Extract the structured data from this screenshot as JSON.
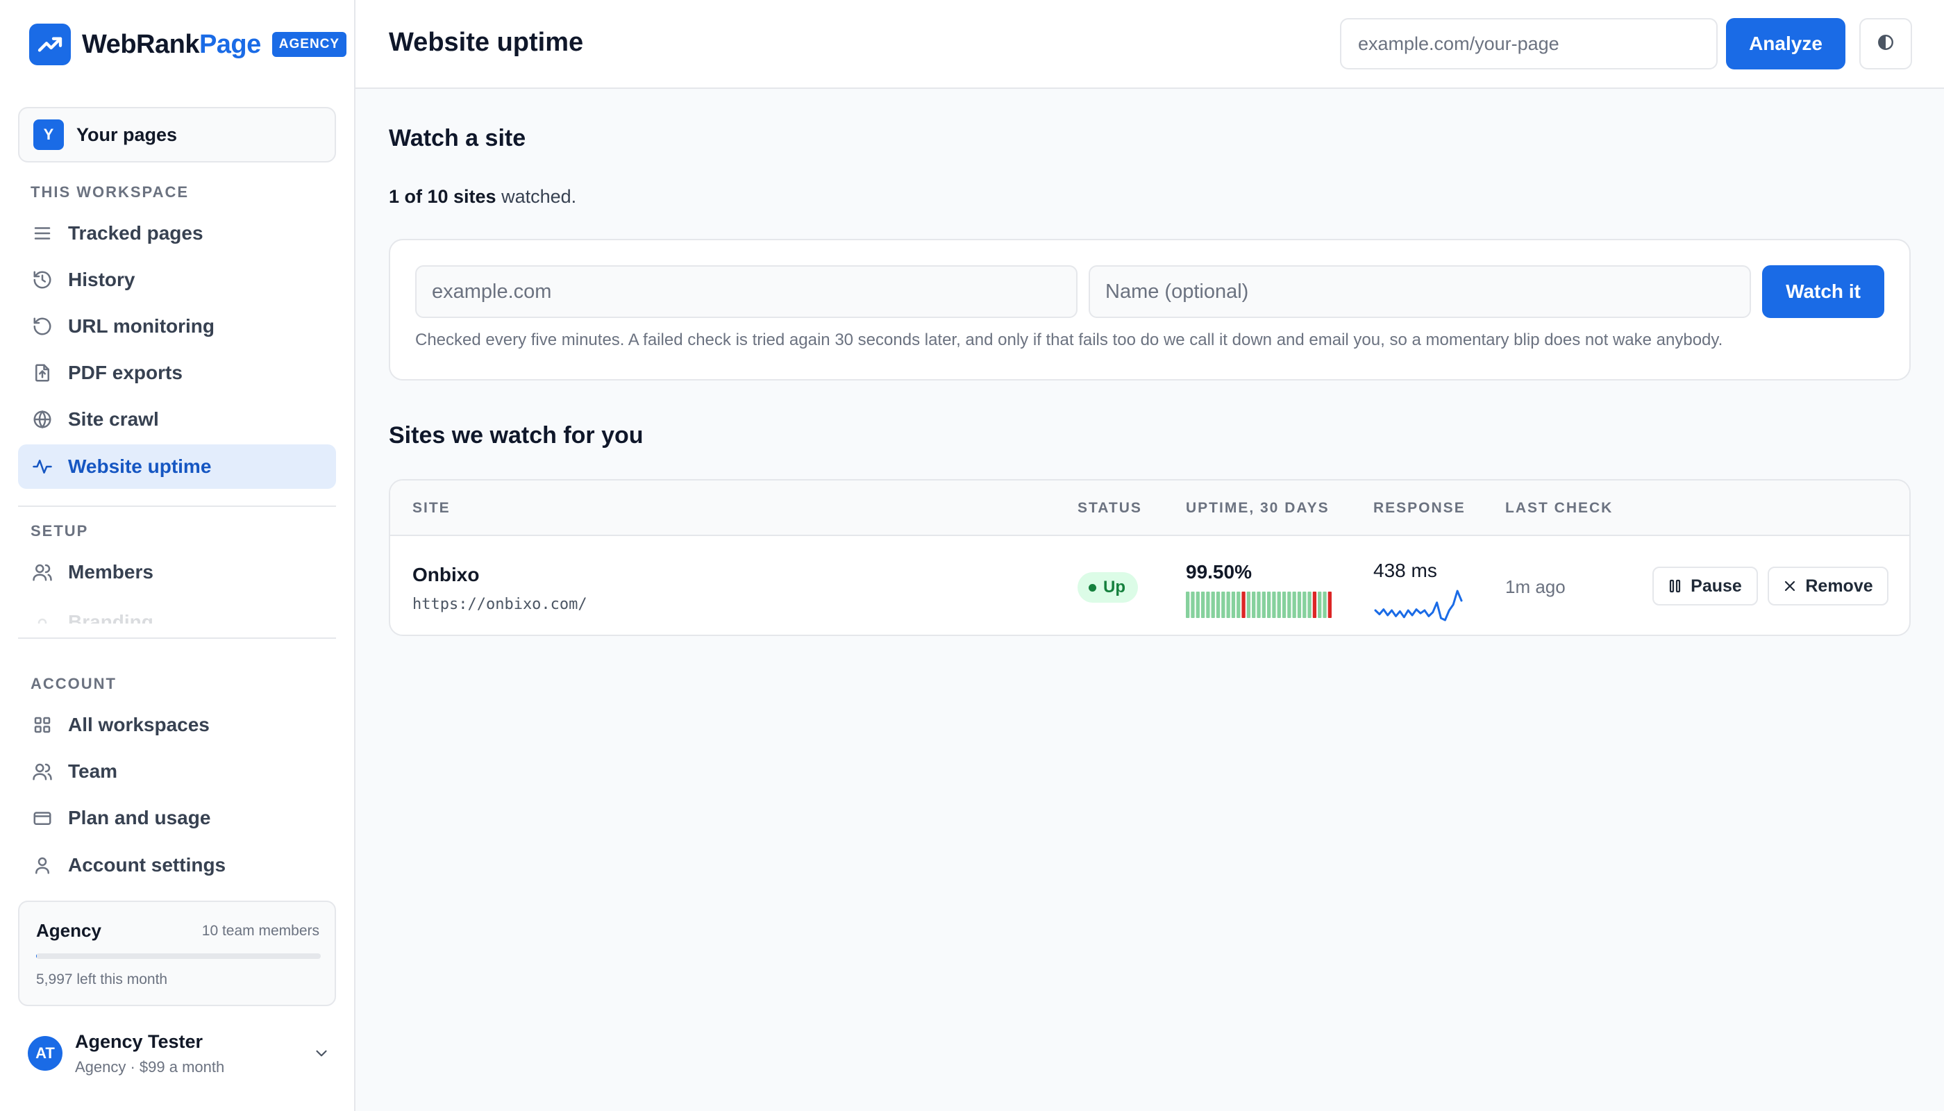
{
  "brand": {
    "name_main": "WebRank",
    "name_accent": "Page",
    "badge": "AGENCY"
  },
  "workspace_switch": {
    "avatar": "Y",
    "label": "Your pages"
  },
  "sidebar": {
    "workspace_section": "THIS WORKSPACE",
    "workspace_items": [
      {
        "label": "Tracked pages",
        "icon": "list-icon"
      },
      {
        "label": "History",
        "icon": "history-icon"
      },
      {
        "label": "URL monitoring",
        "icon": "refresh-icon"
      },
      {
        "label": "PDF exports",
        "icon": "file-export-icon"
      },
      {
        "label": "Site crawl",
        "icon": "globe-icon"
      },
      {
        "label": "Website uptime",
        "icon": "pulse-icon",
        "active": true
      }
    ],
    "setup_section": "SETUP",
    "setup_items": [
      {
        "label": "Members",
        "icon": "users-icon"
      },
      {
        "label": "Branding",
        "icon": "brush-icon"
      }
    ],
    "account_section": "ACCOUNT",
    "account_items": [
      {
        "label": "All workspaces",
        "icon": "grid-icon"
      },
      {
        "label": "Team",
        "icon": "team-icon"
      },
      {
        "label": "Plan and usage",
        "icon": "card-icon"
      },
      {
        "label": "Account settings",
        "icon": "user-icon"
      }
    ]
  },
  "plan": {
    "name": "Agency",
    "members": "10 team members",
    "left": "5,997 left this month",
    "usage_fraction": 0.0005
  },
  "user": {
    "initials": "AT",
    "name": "Agency Tester",
    "plan": "Agency · $99 a month"
  },
  "header": {
    "title": "Website uptime",
    "search_placeholder": "example.com/your-page",
    "analyze_label": "Analyze"
  },
  "watch": {
    "title": "Watch a site",
    "quota_bold": "1 of 10 sites",
    "quota_rest": " watched.",
    "url_placeholder": "example.com",
    "name_placeholder": "Name (optional)",
    "button": "Watch it",
    "help": "Checked every five minutes. A failed check is tried again 30 seconds later, and only if that fails too do we call it down and email you, so a momentary blip does not wake anybody."
  },
  "sites": {
    "title": "Sites we watch for you",
    "columns": [
      "SITE",
      "STATUS",
      "UPTIME, 30 DAYS",
      "RESPONSE",
      "LAST CHECK"
    ],
    "rows": [
      {
        "name": "Onbixo",
        "url": "https://onbixo.com/",
        "status": "Up",
        "uptime": "99.50%",
        "uptime_history": [
          "up",
          "up",
          "up",
          "up",
          "up",
          "up",
          "up",
          "up",
          "up",
          "up",
          "up",
          "down",
          "up",
          "up",
          "up",
          "up",
          "up",
          "up",
          "up",
          "up",
          "up",
          "up",
          "up",
          "up",
          "up",
          "down",
          "up",
          "up",
          "down"
        ],
        "response": "438 ms",
        "response_trend": [
          30,
          34,
          29,
          35,
          30,
          36,
          31,
          37,
          30,
          35,
          29,
          33,
          30,
          36,
          32,
          22,
          38,
          40,
          30,
          24,
          10,
          20
        ],
        "last_check": "1m ago",
        "pause_label": "Pause",
        "remove_label": "Remove"
      }
    ]
  },
  "colors": {
    "accent": "#1a6be6",
    "up": "#15803d",
    "bar_up": "#86d19d",
    "bar_down": "#dc2626"
  }
}
